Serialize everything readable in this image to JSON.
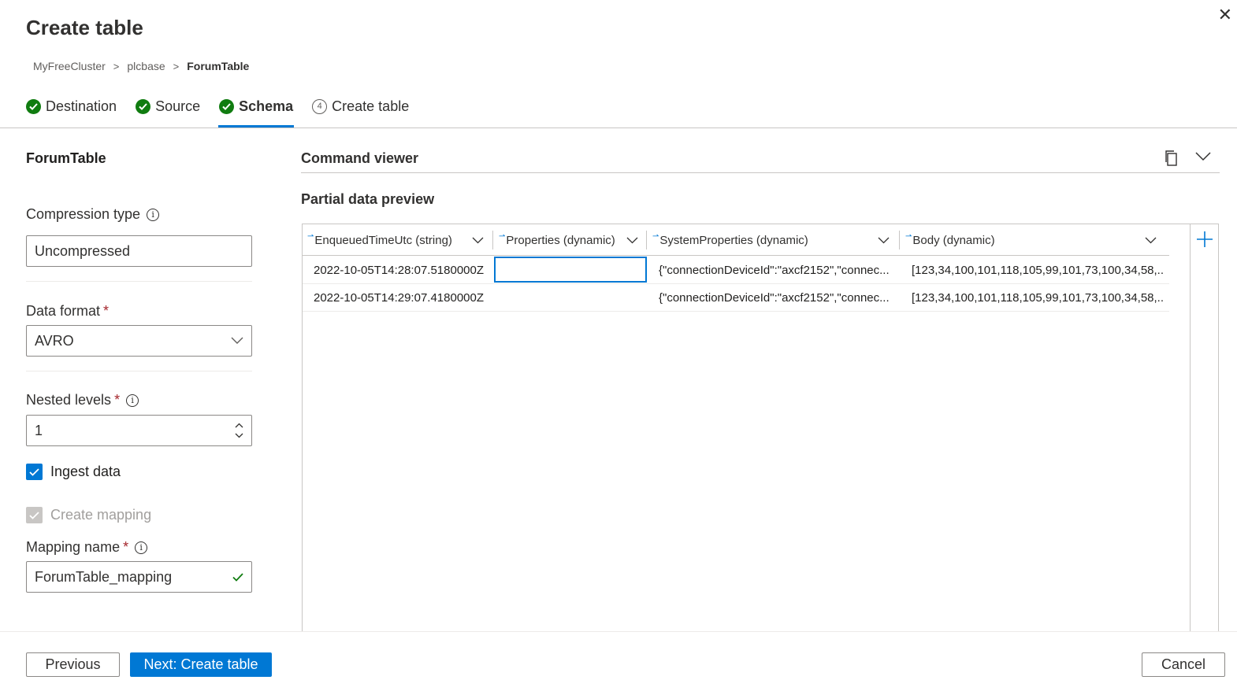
{
  "panel": {
    "title": "Create table"
  },
  "breadcrumb": [
    "MyFreeCluster",
    "plcbase",
    "ForumTable"
  ],
  "steps": [
    {
      "label": "Destination",
      "state": "done"
    },
    {
      "label": "Source",
      "state": "done"
    },
    {
      "label": "Schema",
      "state": "active"
    },
    {
      "label": "Create table",
      "state": "pending",
      "number": "4"
    }
  ],
  "left": {
    "table_name": "ForumTable",
    "compression": {
      "label": "Compression type",
      "value": "Uncompressed"
    },
    "data_format": {
      "label": "Data format",
      "required": "*",
      "value": "AVRO"
    },
    "nested_levels": {
      "label": "Nested levels",
      "required": "*",
      "value": "1"
    },
    "ingest_data": {
      "label": "Ingest data",
      "checked": true
    },
    "create_mapping": {
      "label": "Create mapping",
      "checked": true,
      "disabled": true
    },
    "mapping_name": {
      "label": "Mapping name",
      "required": "*",
      "value": "ForumTable_mapping"
    }
  },
  "right": {
    "command_viewer": "Command viewer",
    "preview_title": "Partial data preview",
    "columns": [
      "EnqueuedTimeUtc (string)",
      "Properties (dynamic)",
      "SystemProperties (dynamic)",
      "Body (dynamic)"
    ],
    "rows": [
      [
        "2022-10-05T14:28:07.5180000Z",
        "",
        "{\"connectionDeviceId\":\"axcf2152\",\"connec...",
        "[123,34,100,101,118,105,99,101,73,100,34,58,..."
      ],
      [
        "2022-10-05T14:29:07.4180000Z",
        "",
        "{\"connectionDeviceId\":\"axcf2152\",\"connec...",
        "[123,34,100,101,118,105,99,101,73,100,34,58,..."
      ]
    ]
  },
  "footer": {
    "previous": "Previous",
    "next": "Next: Create table",
    "cancel": "Cancel"
  },
  "colors": {
    "accent": "#0078d4",
    "success": "#107c10",
    "required": "#a4262c"
  }
}
